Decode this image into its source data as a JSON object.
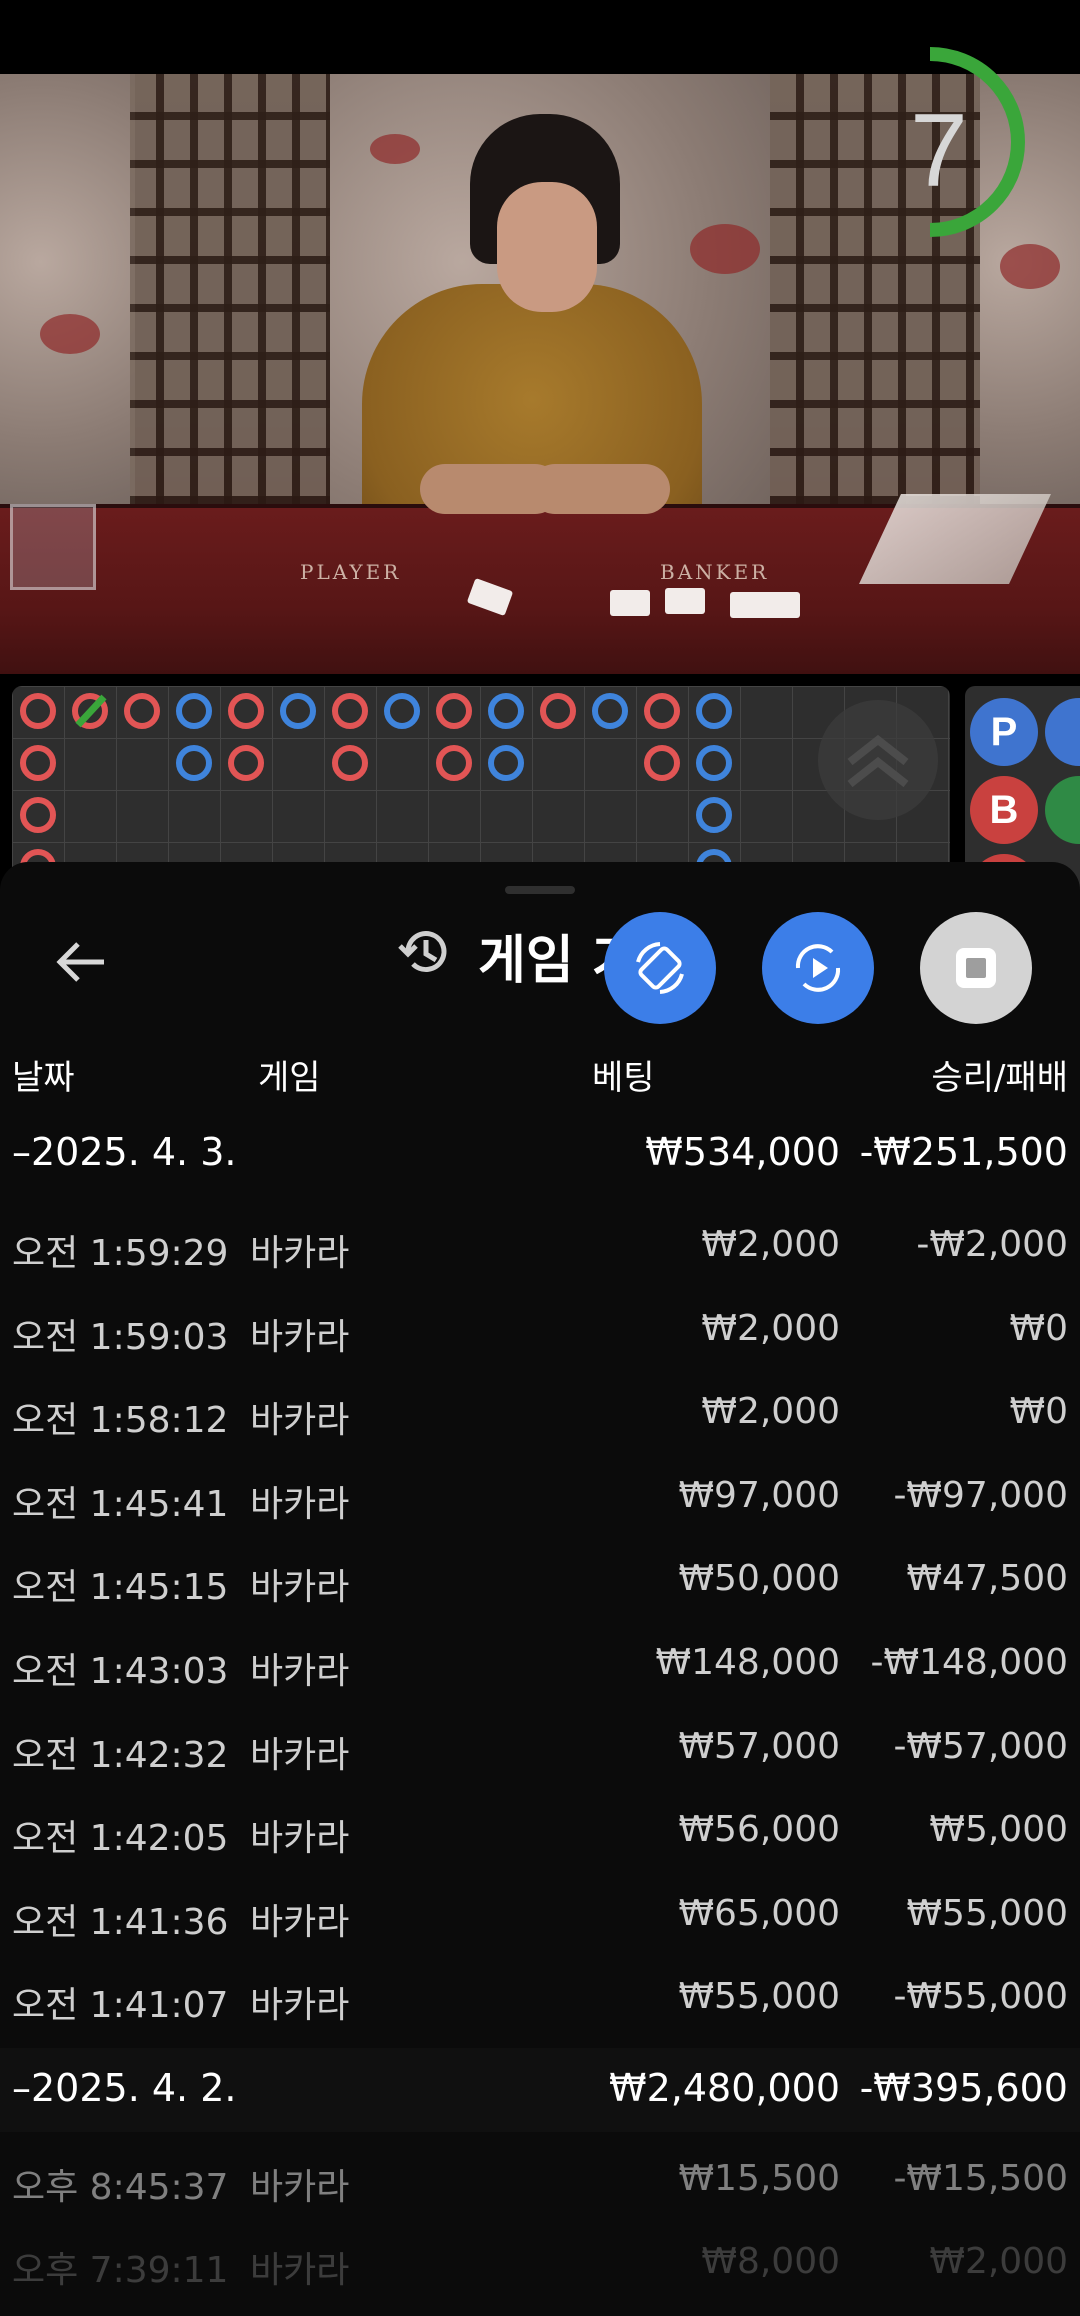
{
  "timer": {
    "seconds": "7"
  },
  "table_labels": {
    "player": "PLAYER",
    "banker": "BANKER"
  },
  "pb_panel": {
    "p": "P",
    "b": "B"
  },
  "sheet": {
    "title": "게임 기",
    "icons": {
      "back": "back-arrow-icon",
      "history": "history-icon",
      "rotate": "rotate-screen-icon",
      "autoplay": "autoplay-icon",
      "stop": "stop-icon"
    }
  },
  "columns": {
    "date": "날짜",
    "game": "게임",
    "bet": "베팅",
    "winloss": "승리/패배"
  },
  "days": [
    {
      "date": "–2025. 4. 3.",
      "bet": "₩534,000",
      "winloss": "-₩251,500"
    },
    {
      "date": "–2025. 4. 2.",
      "bet": "₩2,480,000",
      "winloss": "-₩395,600"
    }
  ],
  "rows": [
    {
      "time": "오전 1:59:29",
      "game": "바카라",
      "bet": "₩2,000",
      "winloss": "-₩2,000"
    },
    {
      "time": "오전 1:59:03",
      "game": "바카라",
      "bet": "₩2,000",
      "winloss": "₩0"
    },
    {
      "time": "오전 1:58:12",
      "game": "바카라",
      "bet": "₩2,000",
      "winloss": "₩0"
    },
    {
      "time": "오전 1:45:41",
      "game": "바카라",
      "bet": "₩97,000",
      "winloss": "-₩97,000"
    },
    {
      "time": "오전 1:45:15",
      "game": "바카라",
      "bet": "₩50,000",
      "winloss": "₩47,500"
    },
    {
      "time": "오전 1:43:03",
      "game": "바카라",
      "bet": "₩148,000",
      "winloss": "-₩148,000"
    },
    {
      "time": "오전 1:42:32",
      "game": "바카라",
      "bet": "₩57,000",
      "winloss": "-₩57,000"
    },
    {
      "time": "오전 1:42:05",
      "game": "바카라",
      "bet": "₩56,000",
      "winloss": "₩5,000"
    },
    {
      "time": "오전 1:41:36",
      "game": "바카라",
      "bet": "₩65,000",
      "winloss": "₩55,000"
    },
    {
      "time": "오전 1:41:07",
      "game": "바카라",
      "bet": "₩55,000",
      "winloss": "-₩55,000"
    }
  ],
  "rows_day2": [
    {
      "time": "오후 8:45:37",
      "game": "바카라",
      "bet": "₩15,500",
      "winloss": "-₩15,500"
    },
    {
      "time": "오후 7:39:11",
      "game": "바카라",
      "bet": "₩8,000",
      "winloss": "₩2,000"
    }
  ],
  "colors": {
    "player_blue": "#3f84dc",
    "banker_red": "#e25555",
    "fab_blue": "#3c7ee8",
    "timer_green": "#3aa63a"
  }
}
